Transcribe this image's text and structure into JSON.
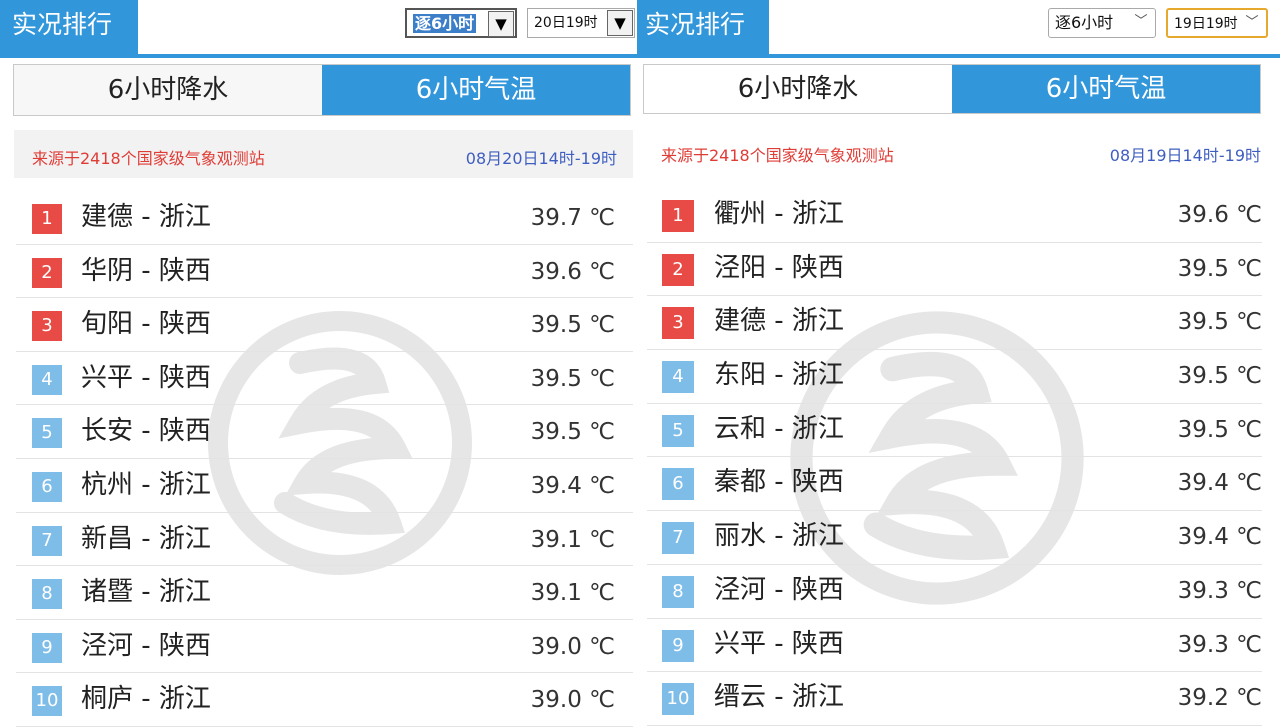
{
  "panels": [
    {
      "title": "实况排行",
      "period_select": "逐6小时",
      "date_select": "20日19时",
      "tabs": [
        "6小时降水",
        "6小时气温"
      ],
      "active_tab": 1,
      "source": "来源于2418个国家级气象观测站",
      "time_range": "08月20日14时-19时",
      "rows": [
        {
          "rank": "1",
          "name": "建德 - 浙江",
          "temp": "39.7 ℃"
        },
        {
          "rank": "2",
          "name": "华阴 - 陕西",
          "temp": "39.6 ℃"
        },
        {
          "rank": "3",
          "name": "旬阳 - 陕西",
          "temp": "39.5 ℃"
        },
        {
          "rank": "4",
          "name": "兴平 - 陕西",
          "temp": "39.5 ℃"
        },
        {
          "rank": "5",
          "name": "长安 - 陕西",
          "temp": "39.5 ℃"
        },
        {
          "rank": "6",
          "name": "杭州 - 浙江",
          "temp": "39.4 ℃"
        },
        {
          "rank": "7",
          "name": "新昌 - 浙江",
          "temp": "39.1 ℃"
        },
        {
          "rank": "8",
          "name": "诸暨 - 浙江",
          "temp": "39.1 ℃"
        },
        {
          "rank": "9",
          "name": "泾河 - 陕西",
          "temp": "39.0 ℃"
        },
        {
          "rank": "10",
          "name": "桐庐 - 浙江",
          "temp": "39.0 ℃"
        }
      ]
    },
    {
      "title": "实况排行",
      "period_select": "逐6小时",
      "date_select": "19日19时",
      "tabs": [
        "6小时降水",
        "6小时气温"
      ],
      "active_tab": 1,
      "source": "来源于2418个国家级气象观测站",
      "time_range": "08月19日14时-19时",
      "rows": [
        {
          "rank": "1",
          "name": "衢州 - 浙江",
          "temp": "39.6 ℃"
        },
        {
          "rank": "2",
          "name": "泾阳 - 陕西",
          "temp": "39.5 ℃"
        },
        {
          "rank": "3",
          "name": "建德 - 浙江",
          "temp": "39.5 ℃"
        },
        {
          "rank": "4",
          "name": "东阳 - 浙江",
          "temp": "39.5 ℃"
        },
        {
          "rank": "5",
          "name": "云和 - 浙江",
          "temp": "39.5 ℃"
        },
        {
          "rank": "6",
          "name": "秦都 - 陕西",
          "temp": "39.4 ℃"
        },
        {
          "rank": "7",
          "name": "丽水 - 浙江",
          "temp": "39.4 ℃"
        },
        {
          "rank": "8",
          "name": "泾河 - 陕西",
          "temp": "39.3 ℃"
        },
        {
          "rank": "9",
          "name": "兴平 - 陕西",
          "temp": "39.3 ℃"
        },
        {
          "rank": "10",
          "name": "缙云 - 浙江",
          "temp": "39.2 ℃"
        }
      ]
    }
  ],
  "colors": {
    "accent_blue": "#3296db",
    "rank_top": "#e84a46",
    "rank_other": "#7fbde9",
    "source_red": "#e03c36",
    "time_blue": "#3f5fc0",
    "right_date_border": "#e7a82e"
  },
  "icons": {
    "dropdown": "chevron-down-icon",
    "watermark": "watermark-logo-icon"
  }
}
